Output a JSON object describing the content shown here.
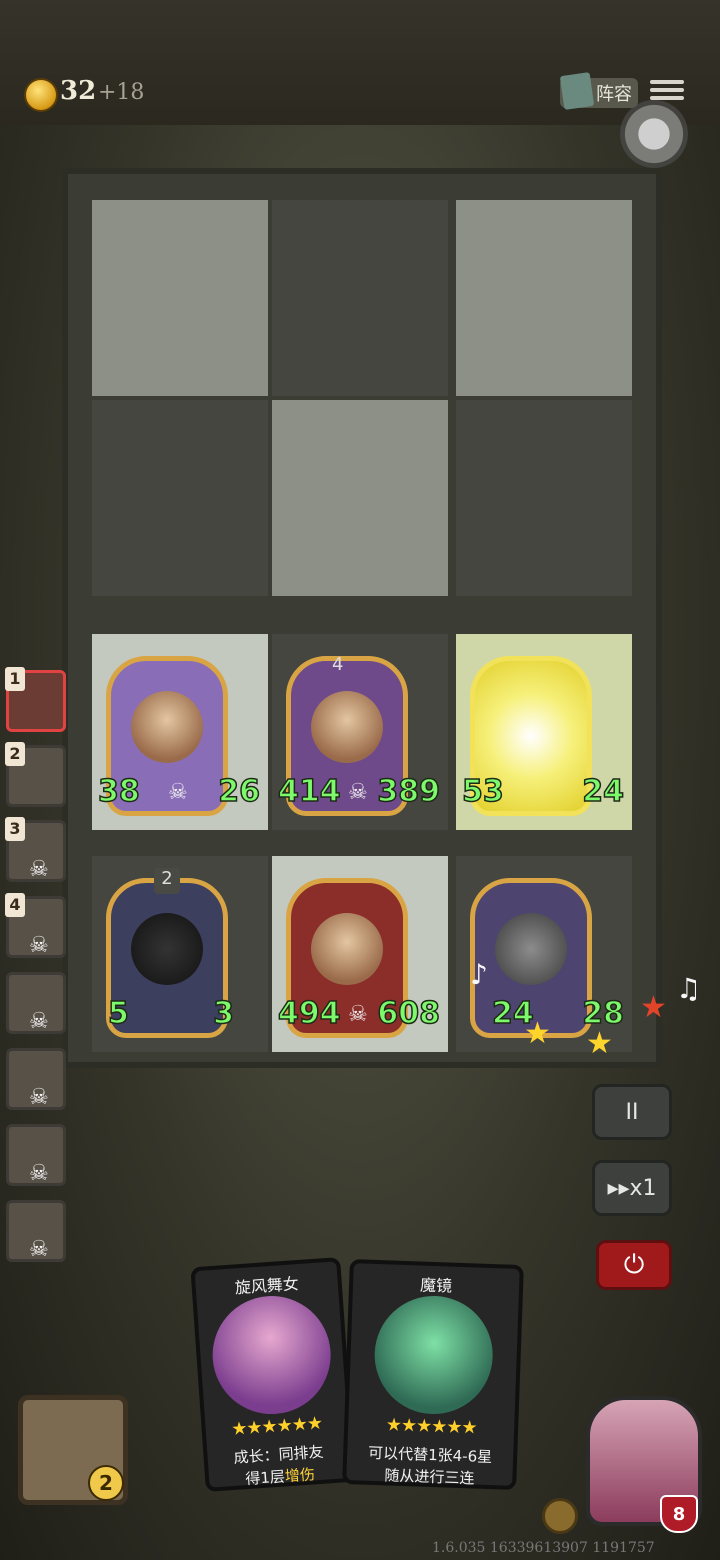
{
  "header": {
    "coins": "32",
    "coins_income": "+18",
    "lineup_label": "阵容"
  },
  "sidebar": {
    "items": [
      {
        "num": "1",
        "active": true
      },
      {
        "num": "2",
        "active": false
      },
      {
        "num": "3",
        "active": false
      },
      {
        "num": "4",
        "active": false
      },
      {
        "num": "",
        "active": false
      },
      {
        "num": "",
        "active": false
      },
      {
        "num": "",
        "active": false
      },
      {
        "num": "",
        "active": false
      }
    ]
  },
  "board": {
    "row1": [
      {
        "atk": "38",
        "hp": "26",
        "level": "",
        "theme": "#8a6db7"
      },
      {
        "atk": "414",
        "hp": "389",
        "level": "4",
        "theme": "#6f4a8a"
      },
      {
        "atk": "53",
        "hp": "24",
        "level": "",
        "theme": "#f6f07a"
      }
    ],
    "row2": [
      {
        "atk": "5",
        "hp": "3",
        "level": "2",
        "theme": "#3c3f5e"
      },
      {
        "atk": "494",
        "hp": "608",
        "level": "",
        "theme": "#8b2e2a"
      },
      {
        "atk": "24",
        "hp": "28",
        "level": "",
        "theme": "#4d4470"
      }
    ]
  },
  "controls": {
    "pause_label": "II",
    "speed_label": "▸▸x1",
    "quit_label": "⏻"
  },
  "shop": {
    "cards": [
      {
        "name": "旋风舞女",
        "stars": "★★★★★★",
        "desc_prefix": "成长：同排友",
        "desc_line2": "得1层",
        "desc_highlight": "增伤"
      },
      {
        "name": "魔镜",
        "stars": "★★★★★★",
        "desc_line1": "可以代替1张4-6星",
        "desc_line2": "随从进行三连"
      }
    ]
  },
  "chest_count": "2",
  "hero_hp": "8",
  "version": "1.6.035 16339613907 1191757"
}
